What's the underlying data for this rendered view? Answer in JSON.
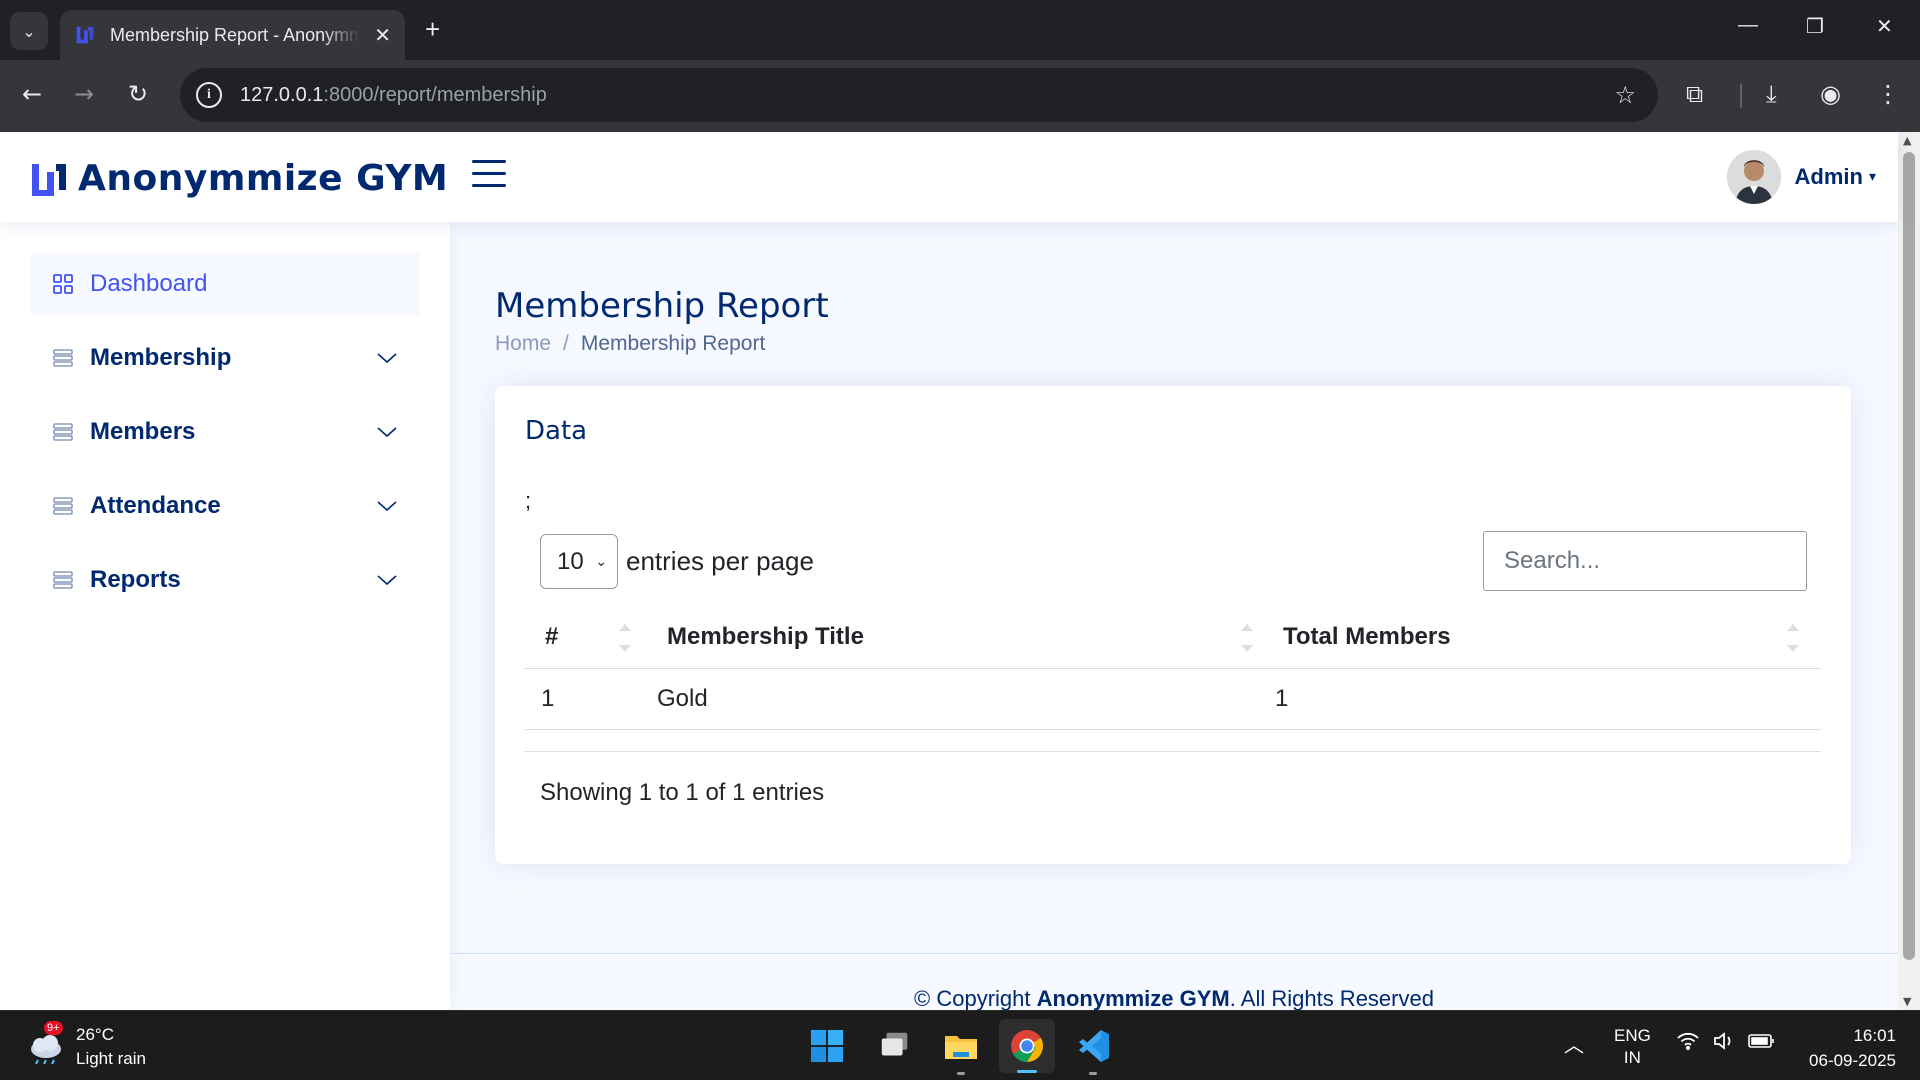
{
  "browser": {
    "tab_title": "Membership Report - Anonymmize GYM",
    "new_tab_label": "+",
    "url_host": "127.0.0.1",
    "url_rest": ":8000/report/membership"
  },
  "header": {
    "brand": "Anonymmize GYM",
    "profile_name": "Admin"
  },
  "sidebar": {
    "items": [
      {
        "label": "Dashboard"
      },
      {
        "label": "Membership"
      },
      {
        "label": "Members"
      },
      {
        "label": "Attendance"
      },
      {
        "label": "Reports"
      }
    ]
  },
  "page": {
    "title": "Membership Report",
    "breadcrumb": {
      "home": "Home",
      "separator": "/",
      "current": "Membership Report"
    }
  },
  "card": {
    "title": "Data",
    "stray_text": ";",
    "per_page_value": "10",
    "per_page_label": "entries per page",
    "search_placeholder": "Search...",
    "columns": [
      "#",
      "Membership Title",
      "Total Members"
    ],
    "rows": [
      {
        "num": "1",
        "title": "Gold",
        "total": "1"
      }
    ],
    "info": "Showing 1 to 1 of 1 entries"
  },
  "footer": {
    "prefix": "© Copyright ",
    "brand": "Anonymmize GYM",
    "suffix": ". All Rights Reserved"
  },
  "taskbar": {
    "weather_temp": "26°C",
    "weather_desc": "Light rain",
    "weather_badge": "9+",
    "lang_top": "ENG",
    "lang_bottom": "IN",
    "time": "16:01",
    "date": "06-09-2025"
  },
  "colors": {
    "brand_navy": "#012970",
    "accent_blue": "#4154f1",
    "page_bg": "#f6f9ff"
  }
}
